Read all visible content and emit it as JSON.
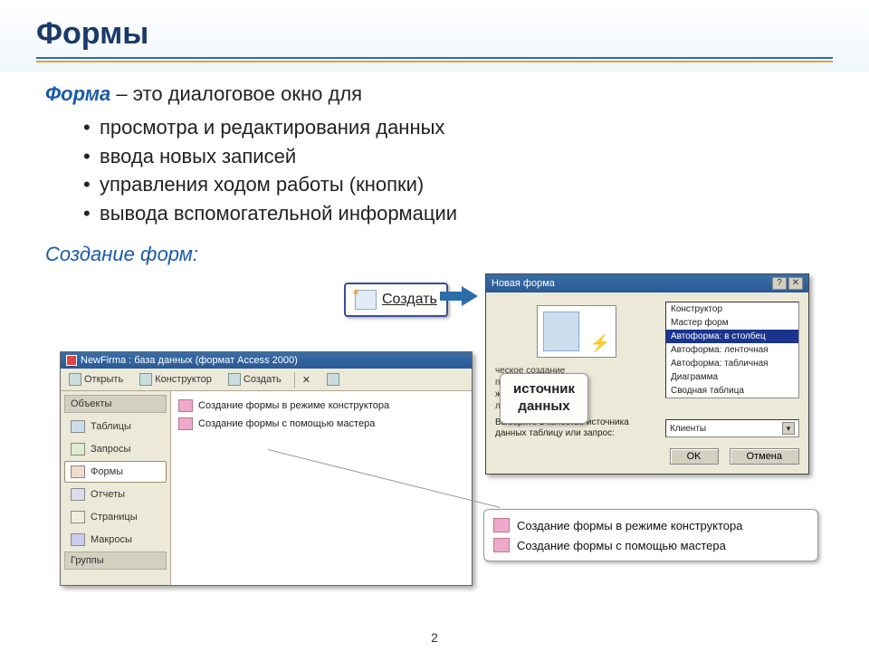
{
  "title": "Формы",
  "lead_em": "Форма",
  "lead_rest": " – это диалоговое окно для",
  "bullets": [
    "просмотра и редактирования данных",
    "ввода новых записей",
    "управления ходом работы (кнопки)",
    "вывода вспомогательной информации"
  ],
  "subhead": "Создание форм:",
  "create_btn": "Создать",
  "db_window": {
    "title": "NewFirma : база данных (формат Access 2000)",
    "toolbar": {
      "open": "Открыть",
      "design": "Конструктор",
      "create": "Создать"
    },
    "sidebar": {
      "header": "Объекты",
      "items": [
        "Таблицы",
        "Запросы",
        "Формы",
        "Отчеты",
        "Страницы",
        "Макросы"
      ],
      "footer": "Группы"
    },
    "rows": [
      "Создание формы в режиме конструктора",
      "Создание формы с помощью мастера"
    ]
  },
  "dialog": {
    "title": "Новая форма",
    "list": [
      "Конструктор",
      "Мастер форм",
      "Автоформа: в столбец",
      "Автоформа: ленточная",
      "Автоформа: табличная",
      "Диаграмма",
      "Сводная таблица"
    ],
    "desc_lines": [
      "ческое создание",
      "полями,",
      "женными в один",
      "лько столбцов."
    ],
    "combo_label": "Выберите в качестве источника данных таблицу или запрос:",
    "combo_value": "Клиенты",
    "ok": "OK",
    "cancel": "Отмена"
  },
  "callouts": {
    "source1": "источник",
    "source2": "данных",
    "zoom": [
      "Создание формы в режиме конструктора",
      "Создание формы с помощью мастера"
    ]
  },
  "page_num": "2"
}
